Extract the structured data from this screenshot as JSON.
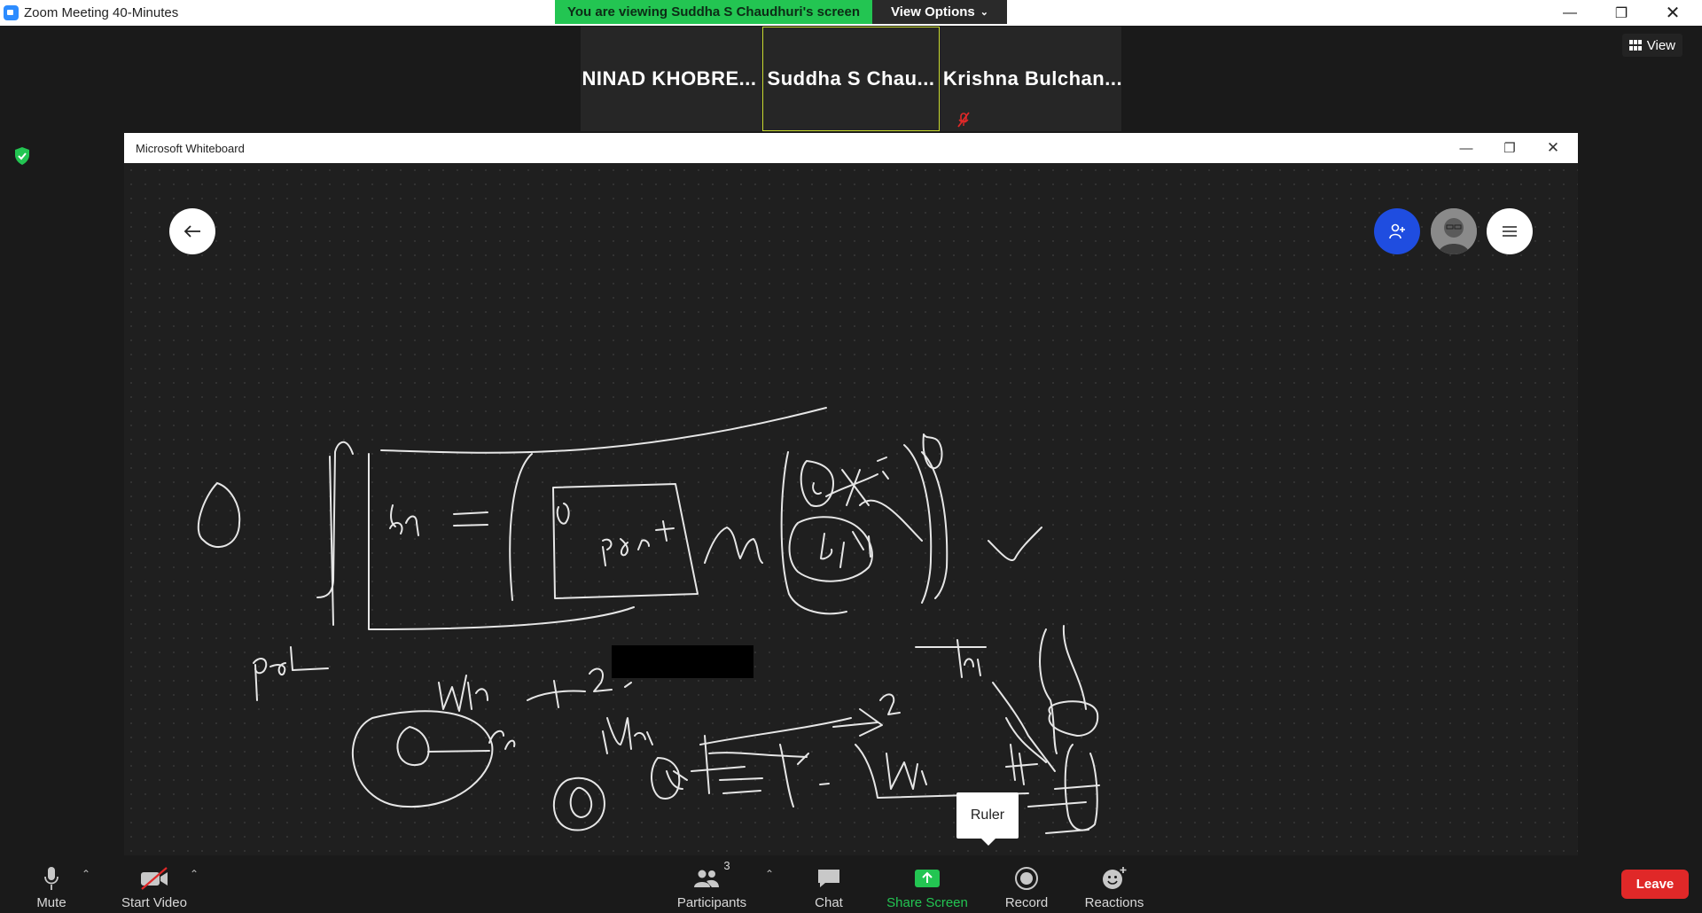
{
  "window": {
    "title": "Zoom Meeting 40-Minutes",
    "viewing_banner": "You are viewing Suddha S Chaudhuri's screen",
    "view_options_label": "View Options",
    "view_label": "View"
  },
  "participants": [
    {
      "name": "NINAD  KHOBRE...",
      "active": false,
      "muted": false
    },
    {
      "name": "Suddha  S  Chau...",
      "active": true,
      "muted": false
    },
    {
      "name": "Krishna  Bulchan...",
      "active": false,
      "muted": true
    }
  ],
  "whiteboard": {
    "title": "Microsoft Whiteboard",
    "tooltip": "Ruler"
  },
  "toolbar": {
    "mute_label": "Mute",
    "start_video_label": "Start Video",
    "participants_label": "Participants",
    "participants_count": "3",
    "chat_label": "Chat",
    "share_screen_label": "Share Screen",
    "record_label": "Record",
    "reactions_label": "Reactions",
    "leave_label": "Leave"
  },
  "colors": {
    "banner_green": "#23c552",
    "share_green": "#23c552",
    "leave_red": "#e02828",
    "active_speaker": "#c7d92e",
    "invite_blue": "#1f4de0"
  }
}
